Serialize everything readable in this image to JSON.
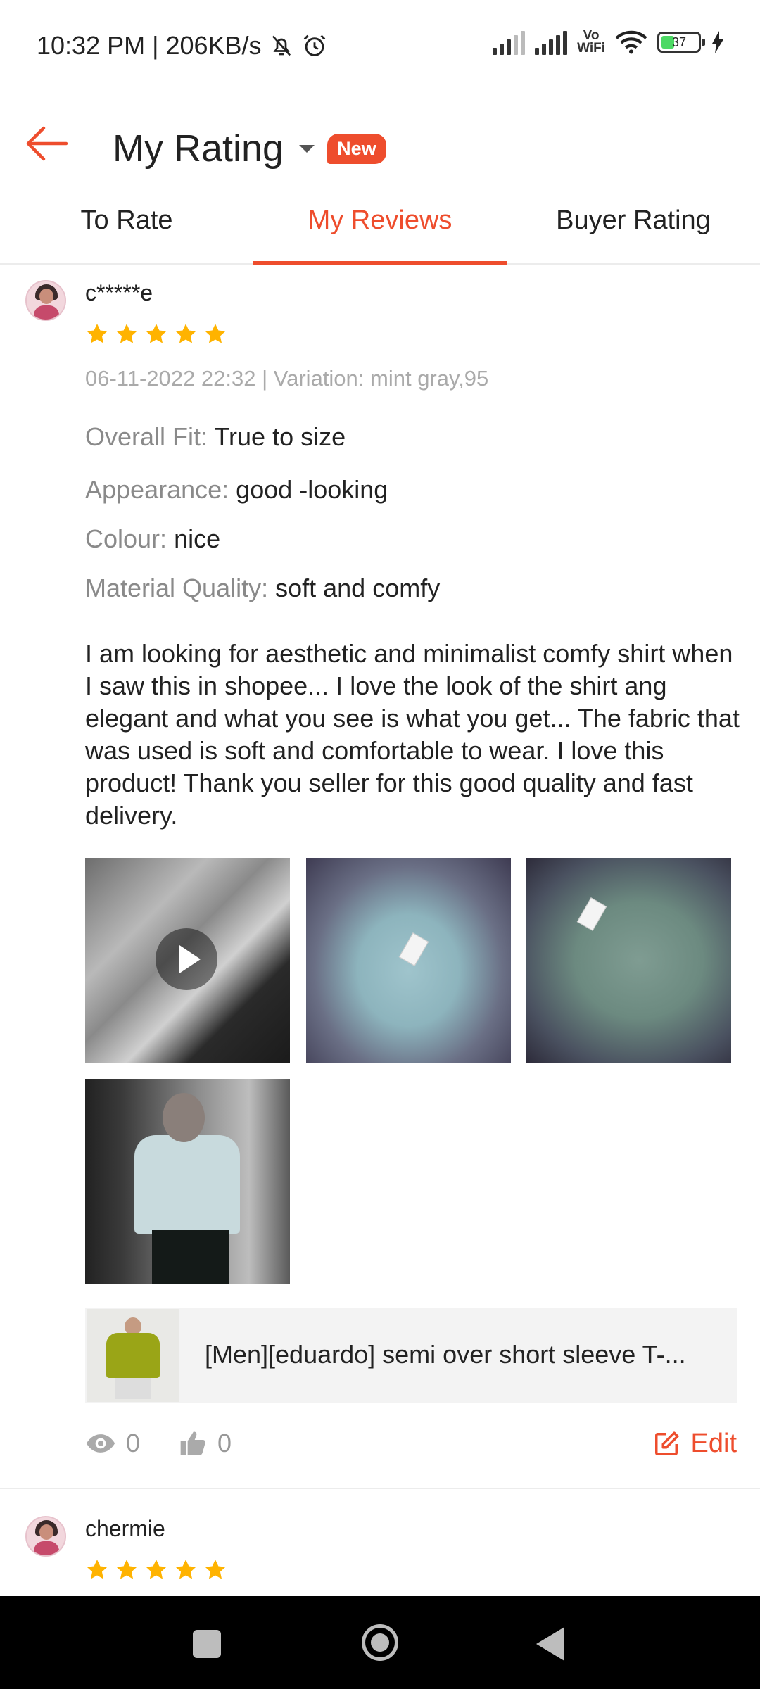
{
  "status_bar": {
    "time": "10:32 PM",
    "separator": "|",
    "speed": "206KB/s",
    "vowifi_top": "Vo",
    "vowifi_bottom": "WiFi",
    "battery": "37"
  },
  "header": {
    "title": "My Rating",
    "badge": "New"
  },
  "tabs": [
    {
      "label": "To Rate",
      "active": false
    },
    {
      "label": "My Reviews",
      "active": true
    },
    {
      "label": "Buyer Rating",
      "active": false
    }
  ],
  "reviews": [
    {
      "username": "c*****e",
      "rating": 5,
      "meta": "06-11-2022 22:32 | Variation: mint gray,95",
      "attributes": [
        {
          "key": "Overall Fit:",
          "value": "True to size"
        },
        {
          "key": "Appearance:",
          "value": "good -looking"
        },
        {
          "key": "Colour:",
          "value": "nice"
        },
        {
          "key": "Material Quality:",
          "value": "soft and comfy"
        }
      ],
      "body": "I am looking for aesthetic and minimalist comfy shirt when I saw this in shopee... I love the look of the shirt ang elegant and what you see is what you get... The fabric that was used  is soft and comfortable to wear. I love this product! Thank you seller for this good quality and fast delivery.",
      "product_name": "[Men][eduardo] semi over short sleeve T-...",
      "views": "0",
      "likes": "0",
      "edit_label": "Edit"
    },
    {
      "username": "chermie",
      "rating": 5
    }
  ],
  "colors": {
    "accent": "#ee4d2d",
    "star": "#ffb300",
    "muted": "#aaaaaa"
  }
}
